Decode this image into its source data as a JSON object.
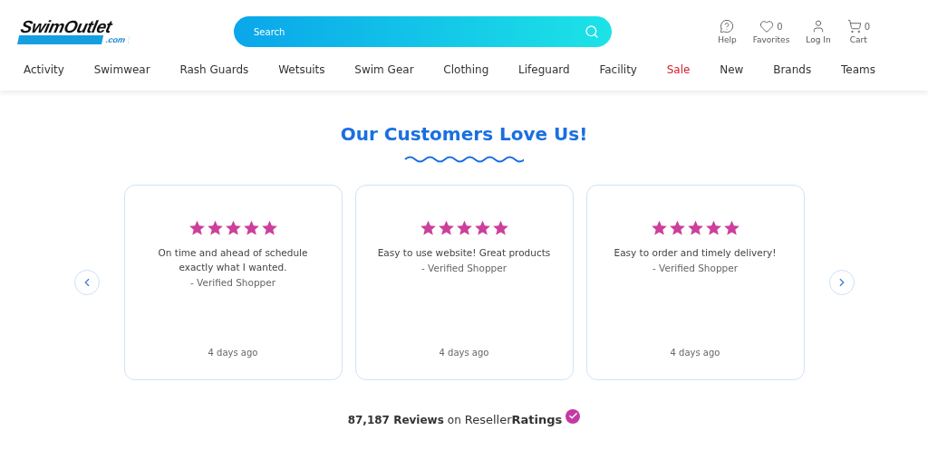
{
  "logo": {
    "name": "SwimOutlet",
    "suffix": ".com"
  },
  "search": {
    "placeholder": "Search"
  },
  "header_actions": [
    {
      "kind": "help",
      "label": "Help"
    },
    {
      "kind": "favorites",
      "label": "Favorites",
      "count": "0"
    },
    {
      "kind": "login",
      "label": "Log In"
    },
    {
      "kind": "cart",
      "label": "Cart",
      "count": "0"
    }
  ],
  "nav": [
    {
      "label": "Activity",
      "kind": "normal"
    },
    {
      "label": "Swimwear",
      "kind": "normal"
    },
    {
      "label": "Rash Guards",
      "kind": "normal"
    },
    {
      "label": "Wetsuits",
      "kind": "normal"
    },
    {
      "label": "Swim Gear",
      "kind": "normal"
    },
    {
      "label": "Clothing",
      "kind": "normal"
    },
    {
      "label": "Lifeguard",
      "kind": "normal"
    },
    {
      "label": "Facility",
      "kind": "normal"
    },
    {
      "label": "Sale",
      "kind": "sale"
    },
    {
      "label": "New",
      "kind": "normal"
    },
    {
      "label": "Brands",
      "kind": "normal"
    },
    {
      "label": "Teams",
      "kind": "normal"
    }
  ],
  "section": {
    "title": "Our Customers Love Us!"
  },
  "reviews": [
    {
      "stars": 5,
      "text": "On time and ahead of schedule exactly what I wanted.",
      "author": "- Verified Shopper",
      "time": "4 days ago"
    },
    {
      "stars": 5,
      "text": "Easy to use website! Great products",
      "author": "- Verified Shopper",
      "time": "4 days ago"
    },
    {
      "stars": 5,
      "text": "Easy to order and timely delivery!",
      "author": "- Verified Shopper",
      "time": "4 days ago"
    }
  ],
  "summary": {
    "count": "87,187 Reviews",
    "on": "on",
    "brand_light": "Reseller",
    "brand_bold": "Ratings"
  }
}
